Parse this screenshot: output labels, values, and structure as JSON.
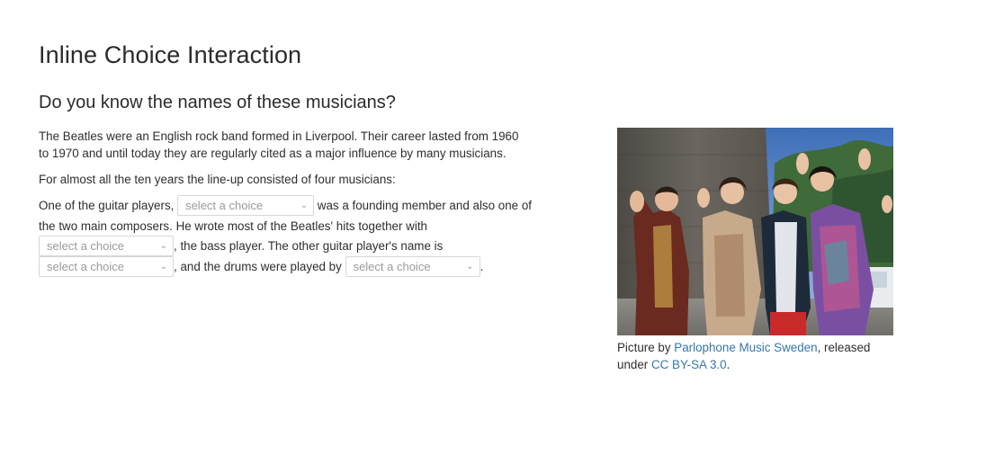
{
  "title": "Inline Choice Interaction",
  "question": "Do you know the names of these musicians?",
  "paragraphs": {
    "intro": "The Beatles were an English rock band formed in Liverpool. Their career lasted from 1960 to 1970 and until today they are regularly cited as a major influence by many musicians.",
    "lineup": "For almost all the ten years the line-up consisted of four musicians:"
  },
  "sentence": {
    "part1": "One of the guitar players, ",
    "part2": " was a founding member and also one of the two main composers. He wrote most of the Beatles' hits together with ",
    "part3": ", the bass player. The other guitar player's name is ",
    "part4": ", and the drums were played by ",
    "part5": "."
  },
  "choices": {
    "choice1": "select a choice",
    "choice2": "select a choice",
    "choice3": "select a choice",
    "choice4": "select a choice"
  },
  "figure": {
    "caption_prefix": "Picture by ",
    "caption_link1": "Parlophone Music Sweden",
    "caption_mid": ", released under ",
    "caption_link2": "CC BY-SA 3.0",
    "caption_suffix": "."
  },
  "colors": {
    "link": "#3576a8",
    "border": "#d7d7d7",
    "placeholder": "#9a9a9a"
  }
}
